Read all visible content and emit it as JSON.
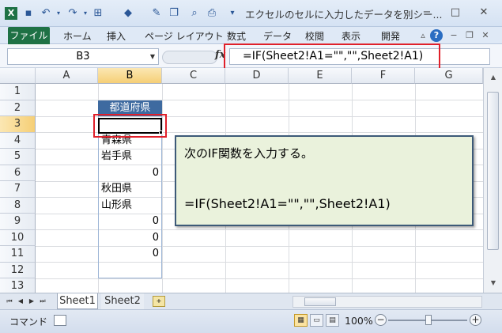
{
  "window": {
    "title": "エクセルのセルに入力したデータを別シー...",
    "app_icon": "excel-icon",
    "controls": [
      "?",
      "−",
      "□",
      "×"
    ]
  },
  "ribbon": {
    "file_tab": "ファイル",
    "tabs": [
      "ホーム",
      "挿入",
      "ページ レイアウト",
      "数式",
      "データ",
      "校閲",
      "表示",
      "開発"
    ]
  },
  "formula_bar": {
    "name_box": "B3",
    "fx_label": "fx",
    "formula": "=IF(Sheet2!A1=\"\",\"\",Sheet2!A1)"
  },
  "grid": {
    "columns": [
      "A",
      "B",
      "C",
      "D",
      "E",
      "F",
      "G"
    ],
    "rows": [
      "1",
      "2",
      "3",
      "4",
      "5",
      "6",
      "7",
      "8",
      "9",
      "10",
      "11",
      "12",
      "13"
    ],
    "cells": {
      "b2": "都道府県",
      "b3": "",
      "b4": "青森県",
      "b5": "岩手県",
      "b6": "0",
      "b7": "秋田県",
      "b8": "山形県",
      "b9": "0",
      "b10": "0",
      "b11": "0"
    },
    "selected_cell": "B3"
  },
  "callout": {
    "line1": "次のIF関数を入力する。",
    "line2": "=IF(Sheet2!A1=\"\",\"\",Sheet2!A1)"
  },
  "sheets": {
    "tabs": [
      "Sheet1",
      "Sheet2"
    ],
    "active": "Sheet1"
  },
  "status": {
    "mode": "コマンド",
    "zoom": "100%"
  },
  "colors": {
    "excel_green": "#1e7145",
    "header_fill": "#3e6aa0",
    "highlight_red": "#e0202a",
    "callout_fill": "#eaf2dc",
    "callout_border": "#3d5a78"
  }
}
